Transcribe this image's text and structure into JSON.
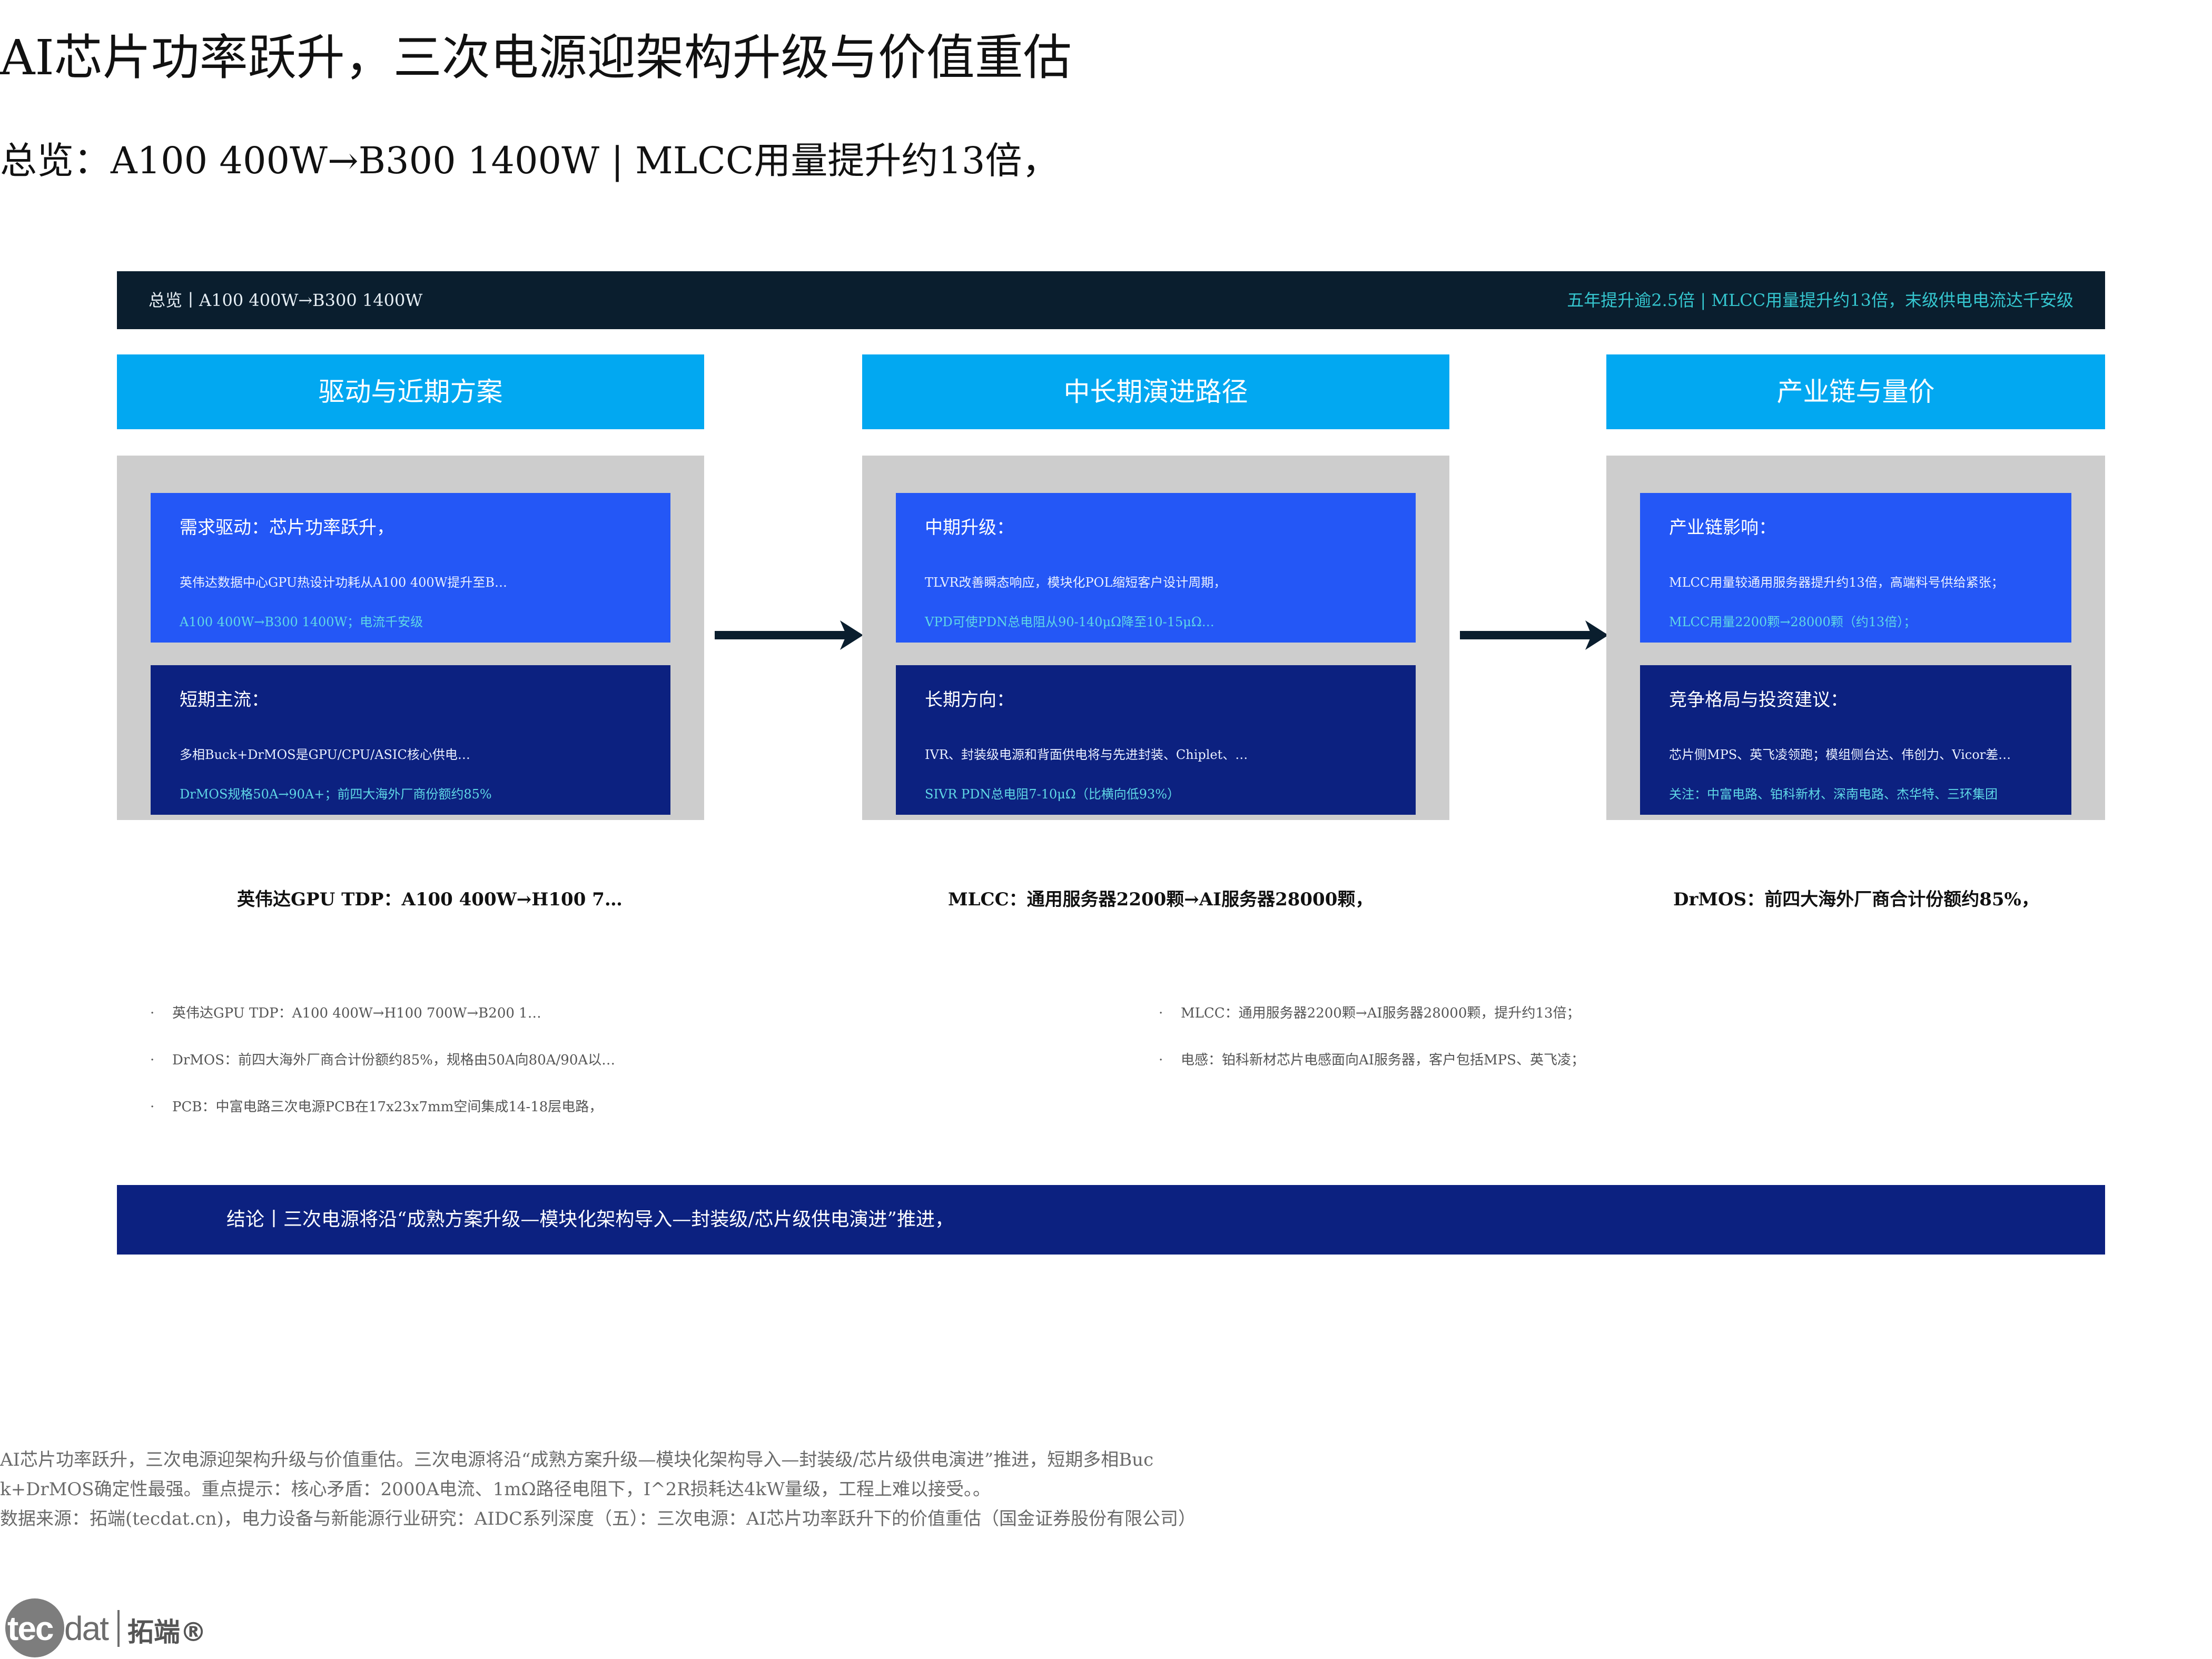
{
  "title": "AI芯片功率跃升，三次电源迎架构升级与价值重估",
  "subtitle": "总览：A100 400W→B300 1400W  |  MLCC用量提升约13倍，",
  "banner": {
    "left": "总览丨A100 400W→B300 1400W",
    "right": "五年提升逾2.5倍  |  MLCC用量提升约13倍，末级供电电流达千安级"
  },
  "columns": [
    {
      "header": "驱动与近期方案",
      "top_card": {
        "heading": "需求驱动：芯片功率跃升，",
        "text": "英伟达数据中心GPU热设计功耗从A100 400W提升至B…",
        "accent": "A100 400W→B300 1400W；电流千安级"
      },
      "bottom_card": {
        "heading": "短期主流：",
        "text": "多相Buck+DrMOS是GPU/CPU/ASIC核心供电…",
        "accent": "DrMOS规格50A→90A+；前四大海外厂商份额约85%"
      },
      "metric": "英伟达GPU TDP：A100 400W→H100 7…"
    },
    {
      "header": "中长期演进路径",
      "top_card": {
        "heading": "中期升级：",
        "text": "TLVR改善瞬态响应，模块化POL缩短客户设计周期，",
        "accent": "VPD可使PDN总电阻从90-140μΩ降至10-15μΩ…"
      },
      "bottom_card": {
        "heading": "长期方向：",
        "text": "IVR、封装级电源和背面供电将与先进封装、Chiplet、…",
        "accent": "SIVR PDN总电阻7-10μΩ（比横向低93%）"
      },
      "metric": "MLCC：通用服务器2200颗→AI服务器28000颗，"
    },
    {
      "header": "产业链与量价",
      "top_card": {
        "heading": "产业链影响：",
        "text": "MLCC用量较通用服务器提升约13倍，高端料号供给紧张；",
        "accent": "MLCC用量2200颗→28000颗（约13倍）；"
      },
      "bottom_card": {
        "heading": "竞争格局与投资建议：",
        "text": "芯片侧MPS、英飞凌领跑；模组侧台达、伟创力、Vicor差…",
        "accent": "关注：中富电路、铂科新材、深南电路、杰华特、三环集团"
      },
      "metric": "DrMOS：前四大海外厂商合计份额约85%，"
    }
  ],
  "bullets_left": [
    "英伟达GPU TDP：A100 400W→H100 700W→B200 1…",
    "DrMOS：前四大海外厂商合计份额约85%，规格由50A向80A/90A以…",
    "PCB：中富电路三次电源PCB在17x23x7mm空间集成14-18层电路，"
  ],
  "bullets_right": [
    "MLCC：通用服务器2200颗→AI服务器28000颗，提升约13倍；",
    "电感：铂科新材芯片电感面向AI服务器，客户包括MPS、英飞凌；"
  ],
  "bullet_marker": "·",
  "conclusion": "结论丨三次电源将沿“成熟方案升级—模块化架构导入—封装级/芯片级供电演进”推进，",
  "notes": [
    "AI芯片功率跃升，三次电源迎架构升级与价值重估。三次电源将沿“成熟方案升级—模块化架构导入—封装级/芯片级供电演进”推进，短期多相Buc",
    "k+DrMOS确定性最强。重点提示：核心矛盾：2000A电流、1mΩ路径电阻下，I^2R损耗达4kW量级，工程上难以接受。。",
    "数据来源：拓端(tecdat.cn)，电力设备与新能源行业研究：AIDC系列深度（五）：三次电源：AI芯片功率跃升下的价值重估（国金证券股份有限公司）"
  ],
  "logo": {
    "tec": "tec",
    "dat": "dat",
    "cn": "拓端®"
  },
  "colors": {
    "banner_bg": "#0a1e2e",
    "banner_accent": "#35c6cf",
    "column_header": "#02a8f1",
    "card_top": "#2457f6",
    "card_bottom": "#0c2180",
    "panel": "#cdcdcd",
    "accent_text": "#5fd8e6"
  }
}
